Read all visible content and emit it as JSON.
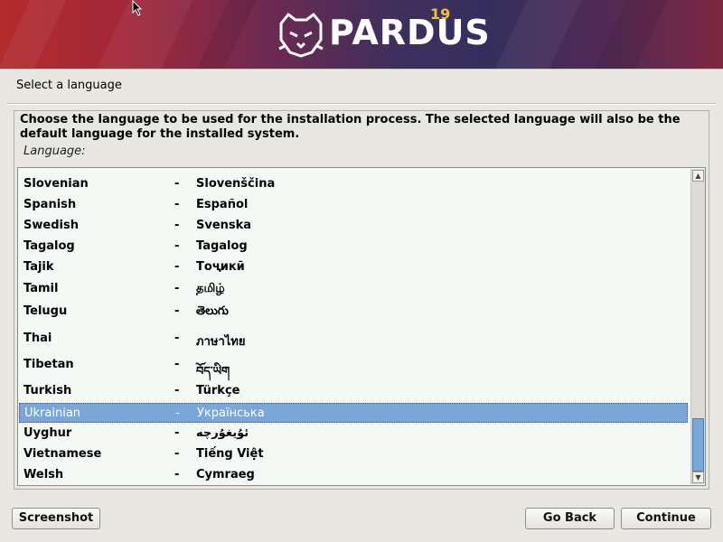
{
  "branding": {
    "name": "PARDUS",
    "version": "19"
  },
  "page": {
    "title": "Select a language"
  },
  "prompt": {
    "description": "Choose the language to be used for the installation process. The selected language will also be the default language for the installed system.",
    "field_label": "Language:"
  },
  "language_list": {
    "separator": "-",
    "selected_index": 10,
    "items": [
      {
        "name": "Slovenian",
        "native": "Slovenščina"
      },
      {
        "name": "Spanish",
        "native": "Español"
      },
      {
        "name": "Swedish",
        "native": "Svenska"
      },
      {
        "name": "Tagalog",
        "native": "Tagalog"
      },
      {
        "name": "Tajik",
        "native": "Тоҷикӣ"
      },
      {
        "name": "Tamil",
        "native": "தமிழ்"
      },
      {
        "name": "Telugu",
        "native": "తెలుగు"
      },
      {
        "name": "Thai",
        "native": "ภาษาไทย"
      },
      {
        "name": "Tibetan",
        "native": "བོད་ཡིག"
      },
      {
        "name": "Turkish",
        "native": "Türkçe"
      },
      {
        "name": "Ukrainian",
        "native": "Українська"
      },
      {
        "name": "Uyghur",
        "native": "ئۇيغۇرچە"
      },
      {
        "name": "Vietnamese",
        "native": "Tiếng Việt"
      },
      {
        "name": "Welsh",
        "native": "Cymraeg"
      }
    ]
  },
  "scrollbar": {
    "up_arrow": "▲",
    "down_arrow": "▼"
  },
  "buttons": {
    "screenshot": "Screenshot",
    "go_back": "Go Back",
    "continue": "Continue"
  },
  "colors": {
    "selection": "#7aa6d8",
    "accent_yellow": "#f0c23b"
  }
}
